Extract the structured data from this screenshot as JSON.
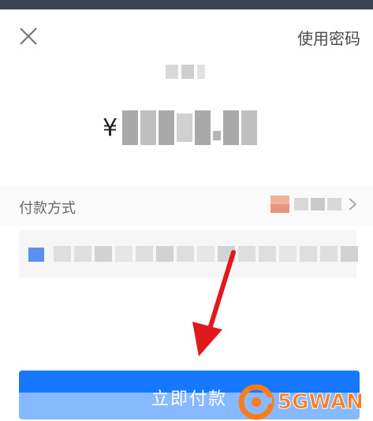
{
  "header": {
    "use_password_label": "使用密码"
  },
  "amount": {
    "currency_symbol": "¥"
  },
  "payment_method": {
    "label": "付款方式"
  },
  "pay_button": {
    "label": "立即付款"
  },
  "watermark": {
    "text": "5GWAN"
  },
  "colors": {
    "primary_button": "#1677ff",
    "arrow": "#e0191f",
    "watermark": "#ff7a1a"
  }
}
